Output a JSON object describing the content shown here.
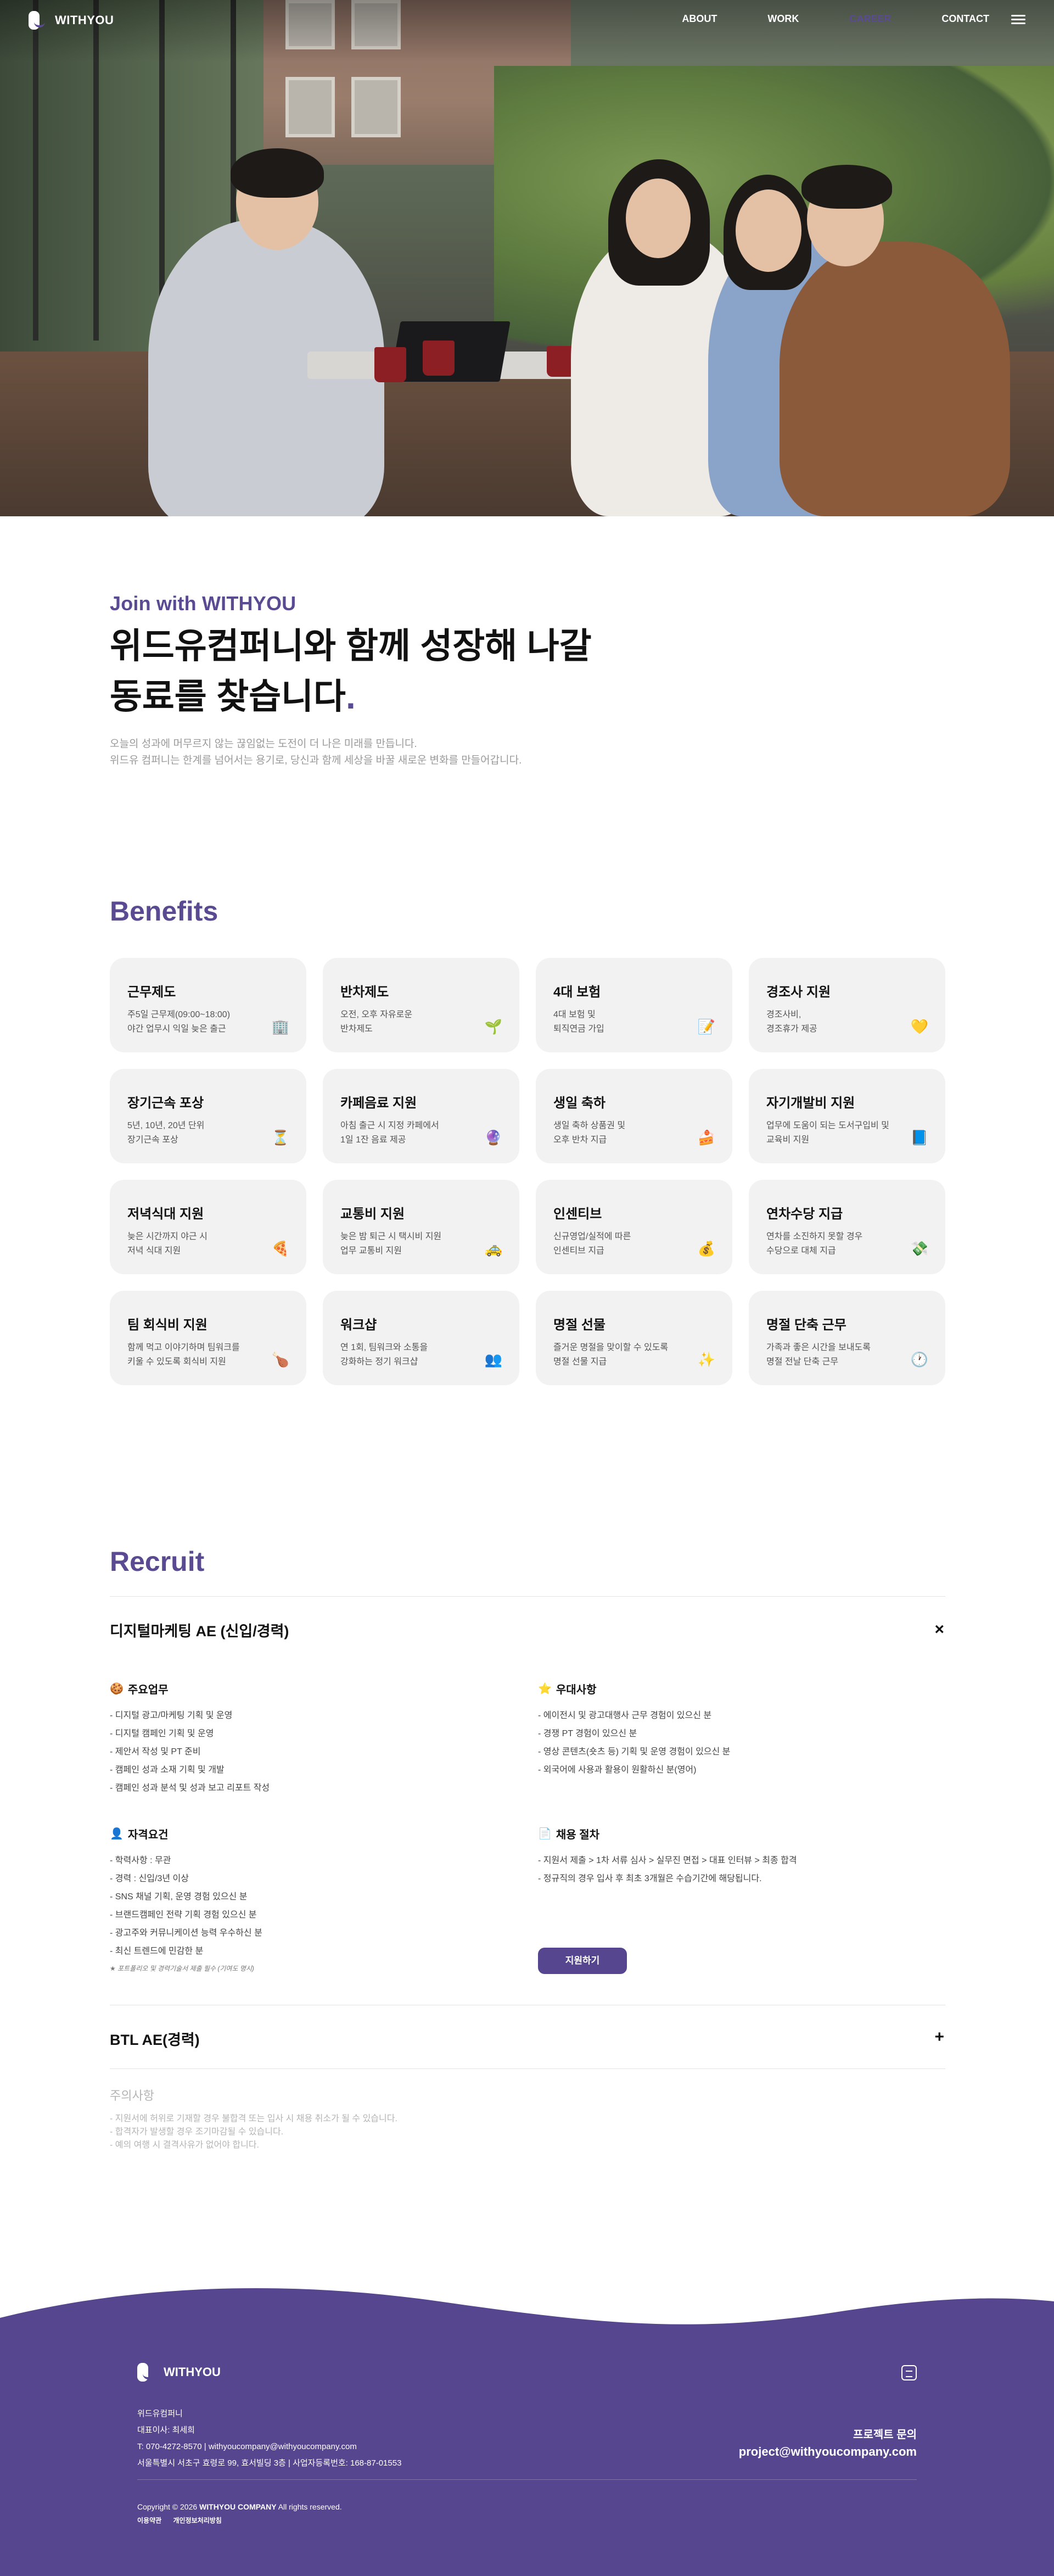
{
  "brand": {
    "name": "WITHYOU",
    "accent": "#5a4a92"
  },
  "nav": {
    "items": [
      {
        "label": "ABOUT",
        "active": false
      },
      {
        "label": "WORK",
        "active": false
      },
      {
        "label": "CAREER",
        "active": true
      },
      {
        "label": "CONTACT",
        "active": false
      }
    ],
    "menu_icon": "hamburger-icon"
  },
  "intro": {
    "eyebrow": "Join with WITHYOU",
    "headline_line1": "위드유컴퍼니와 함께 성장해 나갈",
    "headline_line2": "동료를 찾습니다",
    "headline_dot": ".",
    "desc_line1": "오늘의 성과에 머무르지 않는 끊임없는 도전이 더 나은 미래를 만듭니다.",
    "desc_line2": "위드유 컴퍼니는 한계를 넘어서는 용기로, 당신과 함께 세상을 바꿀 새로운 변화를 만들어갑니다."
  },
  "benefits": {
    "title": "Benefits",
    "items": [
      {
        "title": "근무제도",
        "line1": "주5일 근무제(09:00~18:00)",
        "line2": "야간 업무시 익일 늦은 출근",
        "icon": "🏢"
      },
      {
        "title": "반차제도",
        "line1": "오전, 오후 자유로운",
        "line2": "반차제도",
        "icon": "🌱"
      },
      {
        "title": "4대 보험",
        "line1": "4대 보험 및",
        "line2": "퇴직연금 가입",
        "icon": "📝"
      },
      {
        "title": "경조사 지원",
        "line1": "경조사비,",
        "line2": "경조휴가 제공",
        "icon": "💛"
      },
      {
        "title": "장기근속 포상",
        "line1": "5년, 10년, 20년 단위",
        "line2": "장기근속 포상",
        "icon": "⏳"
      },
      {
        "title": "카페음료 지원",
        "line1": "아침 출근 시 지정 카페에서",
        "line2": "1일 1잔 음료 제공",
        "icon": "🔮"
      },
      {
        "title": "생일 축하",
        "line1": "생일 축하 상품권 및",
        "line2": "오후 반차 지급",
        "icon": "🍰"
      },
      {
        "title": "자기개발비 지원",
        "line1": "업무에 도움이 되는 도서구입비 및",
        "line2": "교육비 지원",
        "icon": "📘"
      },
      {
        "title": "저녁식대 지원",
        "line1": "늦은 시간까지 야근 시",
        "line2": "저녁 식대 지원",
        "icon": "🍕"
      },
      {
        "title": "교통비 지원",
        "line1": "늦은 밤 퇴근 시 택시비 지원",
        "line2": "업무 교통비 지원",
        "icon": "🚕"
      },
      {
        "title": "인센티브",
        "line1": "신규영업/실적에 따른",
        "line2": "인센티브 지급",
        "icon": "💰"
      },
      {
        "title": "연차수당 지급",
        "line1": "연차를 소진하지 못할 경우",
        "line2": "수당으로 대체 지급",
        "icon": "💸"
      },
      {
        "title": "팀 회식비 지원",
        "line1": "함께 먹고 이야기하며 팀워크를",
        "line2": "키울 수 있도록 회식비 지원",
        "icon": "🍗"
      },
      {
        "title": "워크샵",
        "line1": "연 1회, 팀워크와 소통을",
        "line2": "강화하는 정기 워크샵",
        "icon": "👥"
      },
      {
        "title": "명절 선물",
        "line1": "즐거운 명절을 맞이할 수 있도록",
        "line2": "명절 선물 지급",
        "icon": "✨"
      },
      {
        "title": "명절 단축 근무",
        "line1": "가족과 좋은 시간을 보내도록",
        "line2": "명절 전날 단축 근무",
        "icon": "🕐"
      }
    ]
  },
  "recruit": {
    "title": "Recruit",
    "jobs": [
      {
        "title": "디지털마케팅 AE (신입/경력)",
        "toggle": "×",
        "expanded": true
      },
      {
        "title": "BTL AE(경력)",
        "toggle": "+",
        "expanded": false
      }
    ],
    "duties": {
      "title": "주요업무",
      "icon": "🍪",
      "items": [
        "디지털 광고/마케팅 기획 및 운영",
        "디지털 캠페인 기획 및 운영",
        "제안서 작성 및 PT 준비",
        "캠페인 성과 소재 기획 및 개발",
        "캠페인 성과 분석 및 성과 보고 리포트 작성"
      ]
    },
    "preferred": {
      "title": "우대사항",
      "icon": "⭐",
      "items": [
        "에이전시 및 광고대행사 근무 경험이 있으신 분",
        "경쟁 PT 경험이 있으신 분",
        "영상 콘텐츠(숏츠 등) 기획 및 운영 경험이 있으신 분",
        "외국어에 사용과 활용이 원활하신 분(영어)"
      ]
    },
    "qualifications": {
      "title": "자격요건",
      "icon": "👤",
      "items": [
        "학력사항 : 무관",
        "경력 : 신입/3년 이상",
        "SNS 채널 기획, 운영 경험 있으신 분",
        "브랜드캠페인 전략 기획 경험 있으신 분",
        "광고주와 커뮤니케이션 능력 우수하신 분",
        "최신 트렌드에 민감한 분"
      ],
      "note": "★ 포트폴리오 및 경력기술서 제출 필수 (기여도 명시)"
    },
    "process": {
      "title": "채용 절차",
      "icon": "📄",
      "items": [
        "지원서 제출 > 1차 서류 심사 > 실무진 면접 > 대표 인터뷰 > 최종 합격",
        "정규직의 경우 입사 후 최초 3개월은 수습기간에 해당됩니다."
      ]
    },
    "apply_label": "지원하기",
    "caution": {
      "title": "주의사항",
      "items": [
        "지원서에 허위로 기재할 경우 불합격 또는 입사 시 채용 취소가 될 수 있습니다.",
        "합격자가 발생할 경우 조기마감될 수 있습니다.",
        "예의 여행 시 결격사유가 없어야 합니다."
      ]
    }
  },
  "footer": {
    "bg_color": "#56468f",
    "company": "위드유컴퍼니",
    "ceo": "대표이사: 최세희",
    "phone_email": "T: 070-4272-8570  |  withyoucompany@withyoucompany.com",
    "address": "서울특별시 서초구 효령로 99, 효서빌딩 3층  |  사업자등록번호: 168-87-01553",
    "contact_line1": "프로젝트 문의",
    "contact_line2": "project@withyoucompany.com",
    "copyright_prefix": "Copyright © 2026",
    "copyright_company": "WITHYOU COMPANY",
    "copyright_suffix": "All rights reserved.",
    "links": [
      "이용약관",
      "개인정보처리방침"
    ],
    "chat_icon": "chat-icon"
  }
}
